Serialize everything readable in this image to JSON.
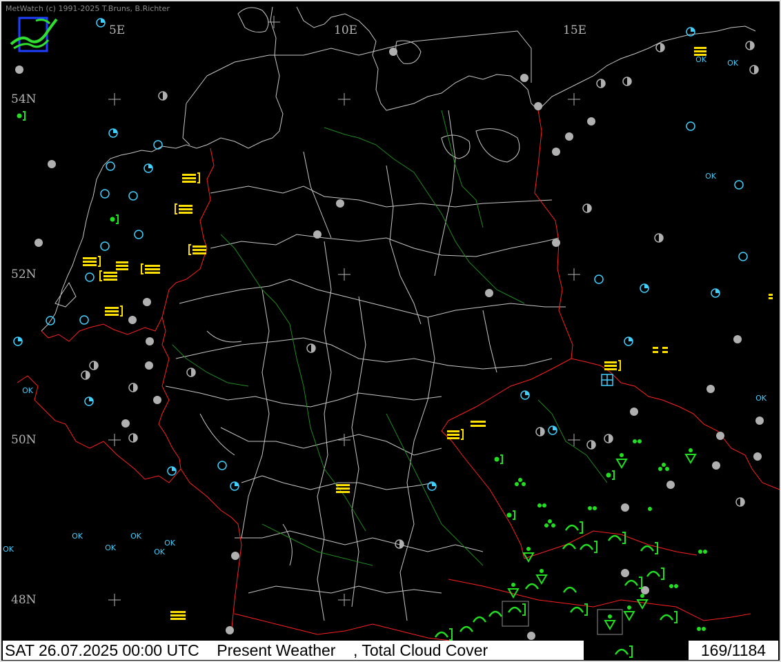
{
  "app": {
    "credit": "MetWatch  (c) 1991-2025 T.Bruns, B.Richter"
  },
  "map": {
    "region": "Germany and neighbouring countries",
    "longitude_labels": [
      "5E",
      "10E",
      "15E"
    ],
    "latitude_labels": [
      "54N",
      "52N",
      "50N",
      "48N"
    ],
    "colors": {
      "background": "#000000",
      "coastline": "#c8c8c8",
      "state_border": "#c8c8c8",
      "national_border": "#ff2020",
      "river": "#1f8a1f",
      "clear_sky": "#40d0ff",
      "cloudy_station": "#b0b0b0",
      "fog": "#ffe000",
      "precipitation": "#20e020"
    },
    "station_symbols": {
      "ok_text": "OK",
      "fog_symbol": "fog-bars-icon",
      "drizzle_symbol": "drizzle-icon",
      "rain_shower_symbol": "rain-shower-icon",
      "thunder_symbol": "thunderstorm-icon"
    }
  },
  "status": {
    "main": "SAT 26.07.2025 00:00 UTC    Present Weather    , Total Cloud Cover",
    "count": "169/1184"
  }
}
